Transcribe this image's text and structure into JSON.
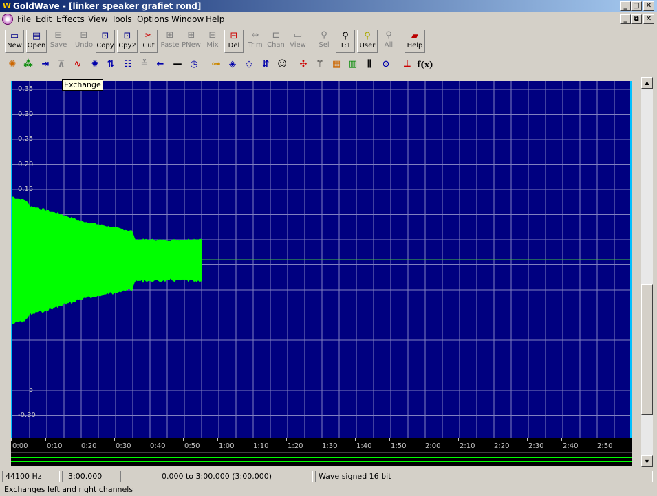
{
  "window": {
    "title": "GoldWave - [linker speaker grafiet rond]",
    "app_icon": "goldwave-icon"
  },
  "menu": [
    "File",
    "Edit",
    "Effects",
    "View",
    "Tools",
    "Options",
    "Window",
    "Help"
  ],
  "toolbar1": [
    {
      "label": "New",
      "icon": "new-icon",
      "enabled": true
    },
    {
      "label": "Open",
      "icon": "open-icon",
      "enabled": true
    },
    {
      "label": "Save",
      "icon": "save-icon",
      "enabled": false
    },
    {
      "label": "Undo",
      "icon": "undo-icon",
      "enabled": false
    },
    {
      "label": "Copy",
      "icon": "copy-icon",
      "enabled": true
    },
    {
      "label": "Cpy2",
      "icon": "copy2-icon",
      "enabled": true
    },
    {
      "label": "Cut",
      "icon": "cut-icon",
      "enabled": true
    },
    {
      "label": "Paste",
      "icon": "paste-icon",
      "enabled": false
    },
    {
      "label": "PNew",
      "icon": "paste-new-icon",
      "enabled": false
    },
    {
      "label": "Mix",
      "icon": "mix-icon",
      "enabled": false
    },
    {
      "label": "Del",
      "icon": "delete-icon",
      "enabled": true
    },
    {
      "label": "Trim",
      "icon": "trim-icon",
      "enabled": false
    },
    {
      "label": "Chan",
      "icon": "channel-icon",
      "enabled": false
    },
    {
      "label": "View",
      "icon": "view-icon",
      "enabled": false
    },
    {
      "label": "Sel",
      "icon": "zoom-selection-icon",
      "enabled": false
    },
    {
      "label": "1:1",
      "icon": "zoom-1to1-icon",
      "enabled": true
    },
    {
      "label": "User",
      "icon": "zoom-user-icon",
      "enabled": true
    },
    {
      "label": "All",
      "icon": "zoom-all-icon",
      "enabled": false
    },
    {
      "label": "Help",
      "icon": "help-book-icon",
      "enabled": true
    }
  ],
  "toolbar2": [
    "spectrum-icon",
    "noise-icon",
    "invert-icon",
    "reverse-level-icon",
    "exchange-icon",
    "gear-icon",
    "swap-arrows-icon",
    "equalizer-icon",
    "compress-icon",
    "left-arrow-icon",
    "flat-line-icon",
    "clock-icon",
    "echo-icon",
    "flanger-icon",
    "doppler-icon",
    "pitch-icon",
    "voice-icon",
    "distortion-icon",
    "filter-icon",
    "spectrum-filter-icon",
    "band-filter-icon",
    "bars-icon",
    "tape-icon",
    "marker-icon",
    "expression-icon"
  ],
  "tooltip": "Exchange",
  "graph": {
    "y_ticks": [
      "0.35",
      "0.30",
      "0.25",
      "0.20",
      "0.15",
      "5",
      "-0.30"
    ],
    "time_ticks": [
      "0:00",
      "0:10",
      "0:20",
      "0:30",
      "0:40",
      "0:50",
      "1:00",
      "1:10",
      "1:20",
      "1:30",
      "1:40",
      "1:50",
      "2:00",
      "2:10",
      "2:20",
      "2:30",
      "2:40",
      "2:50"
    ],
    "colors": {
      "background": "#000080",
      "grid": "#8080c0",
      "wave": "#00ff00",
      "border": "#00c0ff"
    }
  },
  "status": {
    "rate": "44100 Hz",
    "length": "3:00.000",
    "selection": "0.000 to 3:00.000  (3:00.000)",
    "format": "Wave signed 16 bit",
    "hint": "Exchanges left and right channels"
  }
}
